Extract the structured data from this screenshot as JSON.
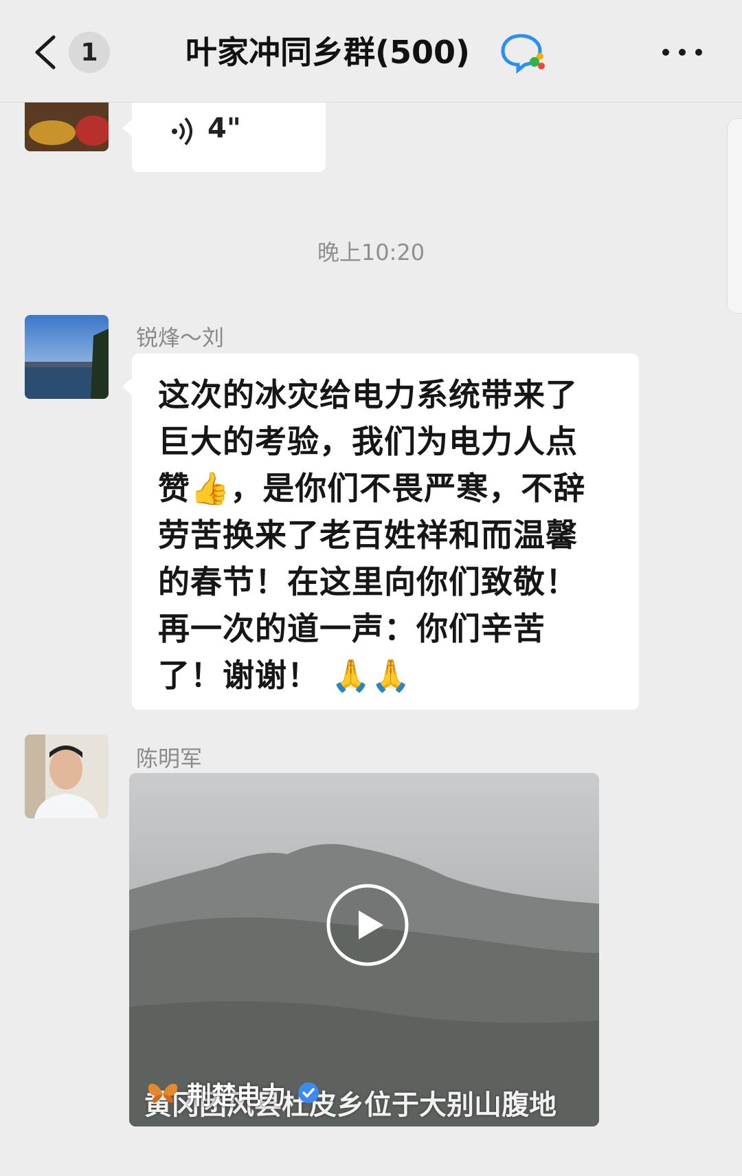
{
  "header": {
    "unread_count": "1",
    "title": "叶家冲同乡群(500)"
  },
  "voice_message": {
    "duration": "4\""
  },
  "timestamp": "晚上10:20",
  "messages": [
    {
      "sender": "锐烽～刘",
      "text_lines": [
        "这次的冰灾给电力系统带来了",
        "巨大的考验，我们为电力人点",
        "赞👍，是你们不畏严寒，不辞",
        "劳苦换来了老百姓祥和而温馨",
        "的春节！在这里向你们致敬！",
        "再一次的道一声：你们辛苦",
        "了！谢谢！ 🙏🙏"
      ]
    },
    {
      "sender": "陈明军",
      "video": {
        "source": "荆楚电力",
        "caption": "黄冈团风县杜皮乡位于大别山腹地"
      }
    }
  ],
  "colors": {
    "background": "#ededed",
    "bubble": "#ffffff",
    "muted_text": "#8a8a8a"
  },
  "icons": [
    "chevron-left-icon",
    "group-chat-icon",
    "more-icon",
    "voice-icon",
    "play-icon",
    "butterfly-logo-icon",
    "verified-icon"
  ]
}
